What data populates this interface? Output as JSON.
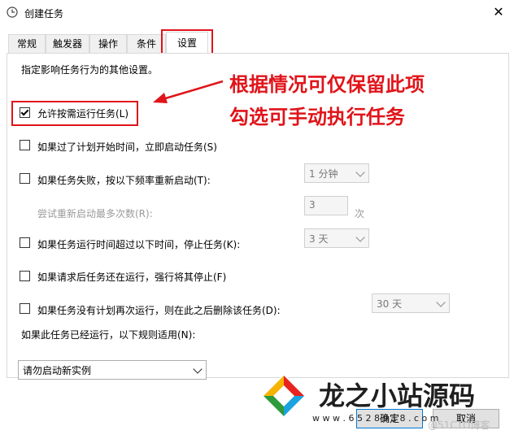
{
  "window": {
    "title": "创建任务",
    "close_glyph": "✕"
  },
  "tabs": [
    {
      "label": "常规"
    },
    {
      "label": "触发器"
    },
    {
      "label": "操作"
    },
    {
      "label": "条件"
    },
    {
      "label": "设置"
    }
  ],
  "active_tab": "设置",
  "settings": {
    "intro": "指定影响任务行为的其他设置。",
    "allow_on_demand": {
      "label": "允许按需运行任务(L)",
      "checked": true
    },
    "run_if_missed": {
      "label": "如果过了计划开始时间，立即启动任务(S)",
      "checked": false
    },
    "restart_on_failure": {
      "label": "如果任务失败，按以下频率重新启动(T):",
      "checked": false,
      "interval": "1 分钟",
      "attempts_label": "尝试重新启动最多次数(R):",
      "attempts_value": "3",
      "attempts_unit": "次"
    },
    "stop_if_runs_longer": {
      "label": "如果任务运行时间超过以下时间，停止任务(K):",
      "checked": false,
      "duration": "3 天"
    },
    "force_stop": {
      "label": "如果请求后任务还在运行，强行将其停止(F)",
      "checked": false
    },
    "delete_if_not_scheduled": {
      "label": "如果任务没有计划再次运行，则在此之后删除该任务(D):",
      "checked": false,
      "duration": "30 天"
    },
    "rule_label": "如果此任务已经运行，以下规则适用(N):",
    "rule_value": "请勿启动新实例"
  },
  "annotation": {
    "line1": "根据情况可仅保留此项",
    "line2": "勾选可手动执行任务",
    "color": "#e0141a"
  },
  "buttons": {
    "ok": "确定",
    "cancel": "取消"
  },
  "watermark": {
    "brand": "龙之小站源码",
    "url": "w w w . 6 5 2 8 9 1 8 . c o m",
    "source": "@51CTO博客"
  }
}
